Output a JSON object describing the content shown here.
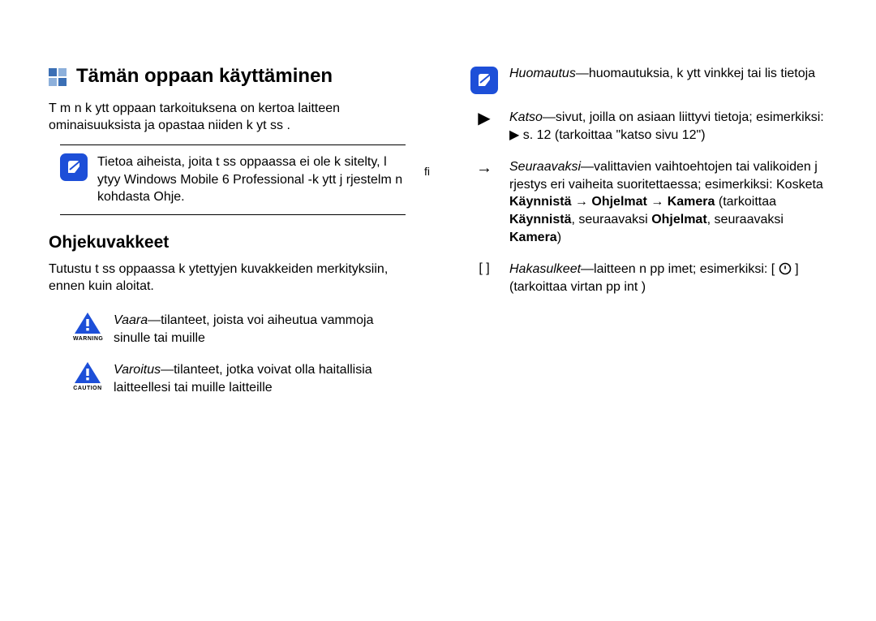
{
  "left": {
    "title": "Tämän oppaan käyttäminen",
    "intro": "T m n k ytt oppaan tarkoituksena on kertoa laitteen ominaisuuksista ja opastaa niiden k yt ss .",
    "note": "Tietoa aiheista, joita t ss  oppaassa ei ole k sitelty, l ytyy Windows Mobile 6 Professional -k ytt j rjestelm n kohdasta Ohje.",
    "fi": "fi",
    "subhead": "Ohjekuvakkeet",
    "sub_intro": "Tutustu t ss  oppaassa k ytettyjen kuvakkeiden merkityksiin, ennen kuin aloitat.",
    "danger_term": "Vaara",
    "danger_sep": "—",
    "danger_body": "tilanteet, joista voi aiheutua vammoja sinulle tai muille",
    "danger_label": "WARNING",
    "caution_term": "Varoitus",
    "caution_sep": "—",
    "caution_body": "tilanteet, jotka voivat olla haitallisia laitteellesi tai muille laitteille",
    "caution_label": "CAUTION"
  },
  "right": {
    "note_term": "Huomautus",
    "note_sep": "—",
    "note_body": "huomautuksia, k ytt vinkkej  tai lis tietoja",
    "see_term": "Katso",
    "see_sep": "—",
    "see_body_a": "sivut, joilla on asiaan liittyvi  tietoja; esimerkiksi:",
    "see_body_b": "▶ s. 12 (tarkoittaa \"katso sivu 12\")",
    "next_term": "Seuraavaksi",
    "next_sep": "—",
    "next_body_a": "valittavien vaihtoehtojen tai valikoiden j rjestys eri vaiheita suoritettaessa; esimerkiksi: Kosketa ",
    "next_b1": "Käynnistä →",
    "next_b2": "Ohjelmat → Kamera",
    "next_body_b": " (tarkoittaa ",
    "next_b3": "Käynnistä",
    "next_body_c": ", seuraavaksi ",
    "next_b4": "Ohjelmat",
    "next_body_d": ", seuraavaksi ",
    "next_b5": "Kamera",
    "next_body_e": ")",
    "br_sym": "[   ]",
    "br_term": "Hakasulkeet",
    "br_sep": "—",
    "br_body_a": "laitteen n pp imet; esimerkiksi: [",
    "br_body_b": "] (tarkoittaa virtan pp int )",
    "arrow_sym": "→",
    "tri_sym": "▶"
  }
}
